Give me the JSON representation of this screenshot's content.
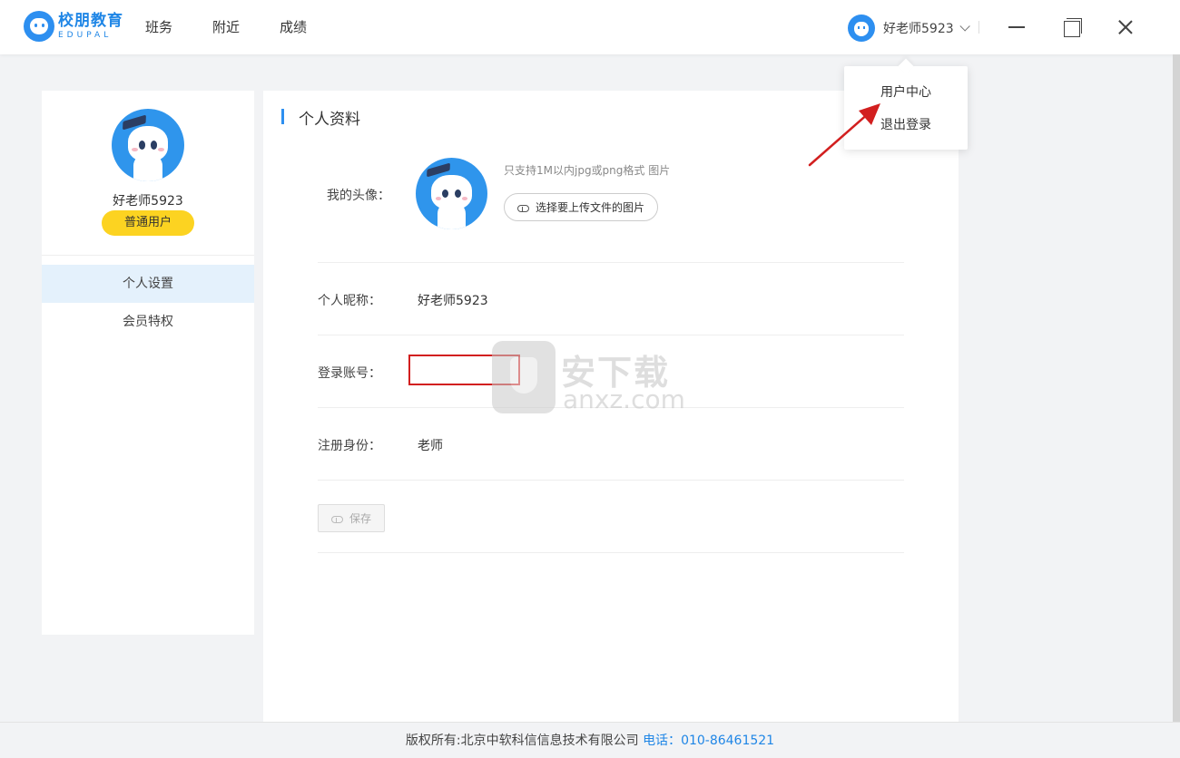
{
  "header": {
    "logo_cn": "校朋教育",
    "logo_en": "EDUPAL",
    "nav": [
      "班务",
      "附近",
      "成绩"
    ],
    "user_name": "好老师5923"
  },
  "dropdown": {
    "items": [
      "用户中心",
      "退出登录"
    ]
  },
  "sidebar": {
    "name": "好老师5923",
    "badge": "普通用户",
    "items": [
      {
        "label": "个人设置",
        "active": true
      },
      {
        "label": "会员特权",
        "active": false
      }
    ]
  },
  "profile": {
    "title": "个人资料",
    "avatar_label": "我的头像：",
    "avatar_hint": "只支持1M以内jpg或png格式 图片",
    "upload_label": "选择要上传文件的图片",
    "nickname_label": "个人昵称：",
    "nickname_value": "好老师5923",
    "account_label": "登录账号：",
    "account_value": "",
    "role_label": "注册身份：",
    "role_value": "老师",
    "save_label": "保存"
  },
  "watermark": {
    "cn": "安下载",
    "en": "anxz.com"
  },
  "footer": {
    "copyright": "版权所有:北京中软科信信息技术有限公司",
    "phone_label": "电话：",
    "phone": "010-86461521"
  },
  "colors": {
    "accent": "#2d8ff0",
    "badge": "#fcd321",
    "active_bg": "#e4f1fc",
    "highlight_box": "#d21f1f",
    "page_bg": "#f2f3f5"
  },
  "icons": [
    "edupal-logo",
    "user-avatar",
    "chevron-down-icon",
    "minimize-icon",
    "maximize-icon",
    "close-icon",
    "cloud-upload-icon",
    "arrow-annotation",
    "anxz-shield-icon"
  ]
}
